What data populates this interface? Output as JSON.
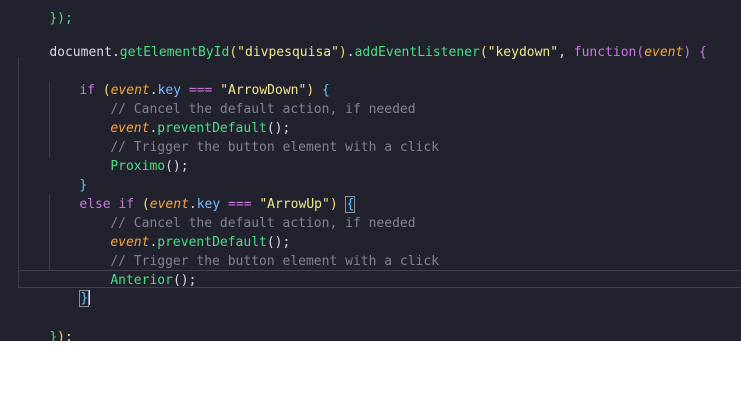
{
  "editor": {
    "top_fragment": "});",
    "line1": {
      "t1": "document",
      "t2": ".",
      "t3": "getElementById",
      "t4": "(",
      "t5": "\"divpesquisa\"",
      "t6": ")",
      "t7": ".",
      "t8": "addEventListener",
      "t9": "(",
      "t10": "\"keydown\"",
      "t11": ", ",
      "t12": "function",
      "t13": "(",
      "t14": "event",
      "t15": ") ",
      "t16": "{"
    },
    "line3": {
      "t1": "if",
      "t2": " (",
      "t3": "event",
      "t4": ".",
      "t5": "key",
      "t6": " === ",
      "t7": "\"ArrowDown\"",
      "t8": ") ",
      "t9": "{"
    },
    "line4": "// Cancel the default action, if needed",
    "line5": {
      "t1": "event",
      "t2": ".",
      "t3": "preventDefault",
      "t4": "();"
    },
    "line6": "// Trigger the button element with a click",
    "line7": {
      "t1": "Proximo",
      "t2": "();"
    },
    "line8": "}",
    "line9": {
      "t1": "else if",
      "t2": " (",
      "t3": "event",
      "t4": ".",
      "t5": "key",
      "t6": " === ",
      "t7": "\"ArrowUp\"",
      "t8": ") ",
      "t9": "{"
    },
    "line10": "// Cancel the default action, if needed",
    "line11": {
      "t1": "event",
      "t2": ".",
      "t3": "preventDefault",
      "t4": "();"
    },
    "line12": "// Trigger the button element with a click",
    "line13": {
      "t1": "Anterior",
      "t2": "();"
    },
    "line14": "}",
    "line16": {
      "t1": "}",
      "t2": ");"
    }
  }
}
